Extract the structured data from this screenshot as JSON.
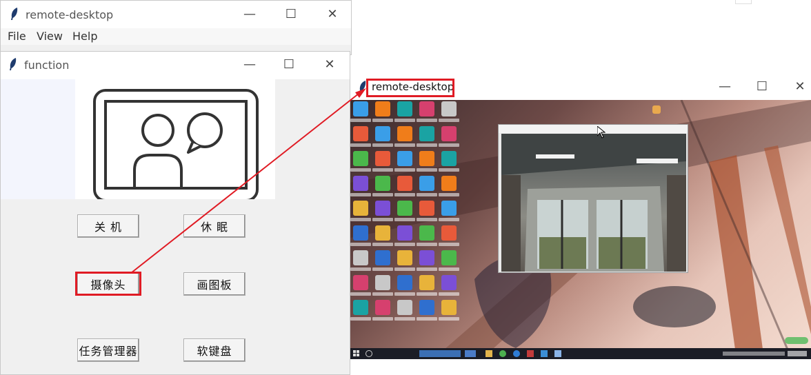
{
  "main_window": {
    "title": "remote-desktop",
    "controls": {
      "minimize": "—",
      "maximize": "☐",
      "close": "✕"
    },
    "menu": {
      "file": "File",
      "view": "View",
      "help": "Help"
    }
  },
  "function_window": {
    "title": "function",
    "controls": {
      "minimize": "—",
      "maximize": "☐",
      "close": "✕"
    },
    "buttons": {
      "shutdown": "关 机",
      "sleep": "休 眠",
      "camera": "摄像头",
      "paint": "画图板",
      "task_manager": "任务管理器",
      "keyboard": "软键盘"
    }
  },
  "remote_window": {
    "title": "remote-desktop",
    "controls": {
      "minimize": "—",
      "maximize": "☐",
      "close": "✕"
    }
  },
  "colors": {
    "highlight": "#e01b24",
    "window_bg": "#f0f0f0"
  }
}
